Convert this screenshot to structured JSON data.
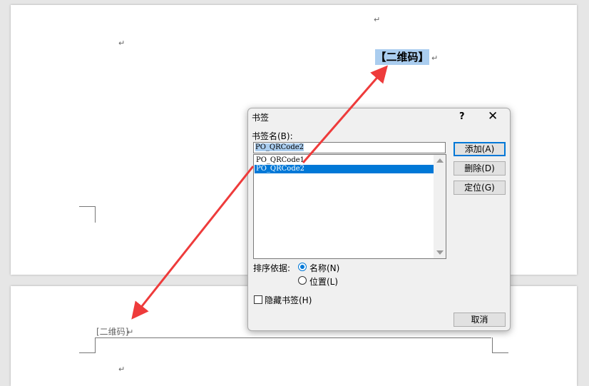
{
  "document": {
    "paragraph_mark": "↵",
    "qr_placeholder_highlighted": "【二维码】",
    "qr_placeholder_bottom": "[二维码]"
  },
  "dialog": {
    "title": "书签",
    "help": "?",
    "close": "✕",
    "name_label": "书签名(B):",
    "name_value": "PO_QRCode2",
    "bookmarks": [
      "PO_QRCode1",
      "PO_QRCode2"
    ],
    "selected_index": 1,
    "buttons": {
      "add": "添加(A)",
      "delete": "删除(D)",
      "goto": "定位(G)",
      "cancel": "取消"
    },
    "sort_label": "排序依据:",
    "sort_options": [
      "名称(N)",
      "位置(L)"
    ],
    "sort_selected": "名称(N)",
    "hidden_label": "隐藏书签(H)",
    "hidden_checked": false
  },
  "colors": {
    "highlight": "#aacdef",
    "selection": "#0078d7",
    "annotation_arrow": "#ee3b3b"
  }
}
